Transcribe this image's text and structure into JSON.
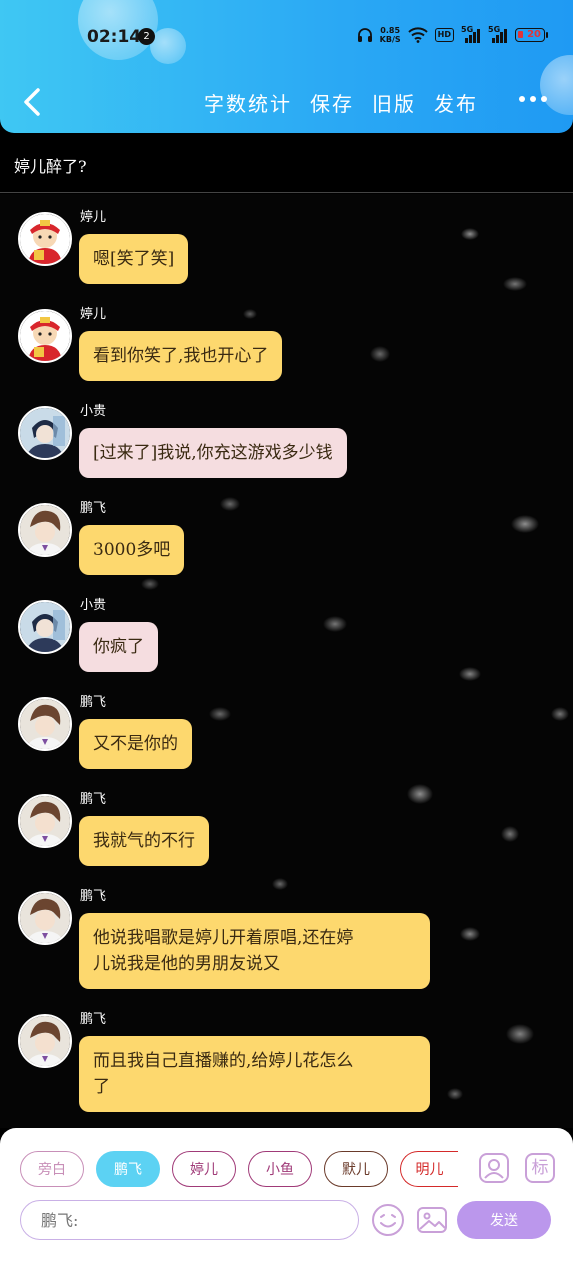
{
  "status_bar": {
    "time": "02:14",
    "notification_count": "2",
    "net_speed_value": "0.85",
    "net_speed_unit": "KB/S",
    "hd_label": "HD",
    "signal1_label": "5G",
    "signal2_label": "5G",
    "battery_level": "20"
  },
  "nav": {
    "actions": [
      "字数统计",
      "保存",
      "旧版",
      "发布"
    ]
  },
  "chat": {
    "title": "婷儿醉了?"
  },
  "messages": [
    {
      "sender": "婷儿",
      "avatar": "avatar-tinger",
      "text": "嗯[笑了笑]",
      "style": "yellow"
    },
    {
      "sender": "婷儿",
      "avatar": "avatar-tinger",
      "text": "看到你笑了,我也开心了",
      "style": "yellow"
    },
    {
      "sender": "小贵",
      "avatar": "avatar-xiaogui",
      "text": "[过来了]我说,你充这游戏多少钱",
      "style": "pink"
    },
    {
      "sender": "鹏飞",
      "avatar": "avatar-pengfei",
      "text": "3000多吧",
      "style": "yellow"
    },
    {
      "sender": "小贵",
      "avatar": "avatar-xiaogui",
      "text": "你疯了",
      "style": "pink"
    },
    {
      "sender": "鹏飞",
      "avatar": "avatar-pengfei",
      "text": "又不是你的",
      "style": "yellow"
    },
    {
      "sender": "鹏飞",
      "avatar": "avatar-pengfei",
      "text": "我就气的不行",
      "style": "yellow"
    },
    {
      "sender": "鹏飞",
      "avatar": "avatar-pengfei",
      "text_line1": "他说我唱歌是婷儿开着原唱,还在婷",
      "text_line2": "儿说我是他的男朋友说又",
      "style": "yellow"
    },
    {
      "sender": "鹏飞",
      "avatar": "avatar-pengfei",
      "text_line1": "而且我自己直播赚的,给婷儿花怎么",
      "text_line2": "了",
      "style": "yellow"
    }
  ],
  "roles": [
    {
      "label": "旁白",
      "color": "#c88fb8",
      "active": false
    },
    {
      "label": "鹏飞",
      "color": "#5cd2f3",
      "active": true
    },
    {
      "label": "婷儿",
      "color": "#a03a78",
      "active": false
    },
    {
      "label": "小鱼",
      "color": "#a03a78",
      "active": false
    },
    {
      "label": "默儿",
      "color": "#6a3a2a",
      "active": false
    },
    {
      "label": "明儿",
      "color": "#d42a2a",
      "active": false
    }
  ],
  "composer": {
    "placeholder": "鹏飞:",
    "send_label": "发送",
    "mark_label": "标"
  },
  "colors": {
    "header_start": "#3fc7f3",
    "header_end": "#1f9af3",
    "bubble_yellow": "#fdd86e",
    "bubble_pink": "#f5dde0",
    "send_button": "#bb97ec",
    "active_role": "#5cd2f3"
  }
}
